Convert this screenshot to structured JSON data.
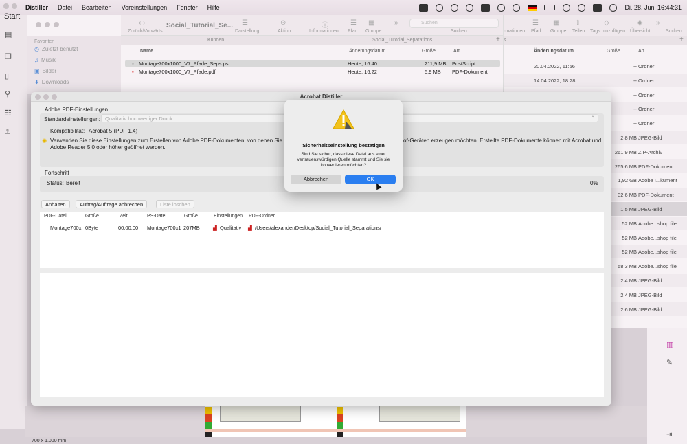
{
  "menubar": {
    "app": "Distiller",
    "items": [
      "Datei",
      "Bearbeiten",
      "Voreinstellungen",
      "Fenster",
      "Hilfe"
    ],
    "clock": "Di. 28. Juni  16:44:31"
  },
  "left_app": {
    "start_label": "Start"
  },
  "finder1": {
    "title": "Social_Tutorial_Se...",
    "toolbar_labels": [
      "Zurück/Vorwärts",
      "Darstellung",
      "Aktion",
      "Informationen",
      "Pfad",
      "Gruppe",
      "Suchen"
    ],
    "search_placeholder": "Suchen",
    "path_tabs": [
      "Kunden",
      "Social_Tutorial_Separations"
    ],
    "sidebar_header": "Favoriten",
    "sidebar_items": [
      "Zuletzt benutzt",
      "Musik",
      "Bilder",
      "Downloads"
    ],
    "columns": [
      "Name",
      "Änderungsdatum",
      "Größe",
      "Art"
    ],
    "files": [
      {
        "name": "Montage700x1000_V7_Pfade_Seps.ps",
        "date": "Heute, 16:40",
        "size": "211,9 MB",
        "kind": "PostScript"
      },
      {
        "name": "Montage700x1000_V7_Pfade.pdf",
        "date": "Heute, 16:22",
        "size": "5,9 MB",
        "kind": "PDF-Dokument"
      }
    ]
  },
  "finder2": {
    "toolbar_labels": [
      "rmationen",
      "Pfad",
      "Gruppe",
      "Teilen",
      "Tags hinzufügen",
      "Übersicht",
      "Suchen"
    ],
    "columns": [
      "Änderungsdatum",
      "Größe",
      "Art"
    ],
    "rows": [
      {
        "date": "20.04.2022, 11:56",
        "size": "--",
        "kind": "Ordner"
      },
      {
        "date": "14.04.2022, 18:28",
        "size": "--",
        "kind": "Ordner"
      },
      {
        "date": "",
        "size": "--",
        "kind": "Ordner"
      },
      {
        "date": "",
        "size": "--",
        "kind": "Ordner"
      },
      {
        "date": "",
        "size": "--",
        "kind": "Ordner"
      },
      {
        "date": "",
        "size": "2,8 MB",
        "kind": "JPEG-Bild"
      },
      {
        "date": "",
        "size": "261,9 MB",
        "kind": "ZIP-Archiv"
      },
      {
        "date": "",
        "size": "265,6 MB",
        "kind": "PDF-Dokument"
      },
      {
        "date": "",
        "size": "1,92 GB",
        "kind": "Adobe I...kument"
      },
      {
        "date": "",
        "size": "32,6 MB",
        "kind": "PDF-Dokument"
      },
      {
        "date": "",
        "size": "1,5 MB",
        "kind": "JPEG-Bild"
      },
      {
        "date": "",
        "size": "52 MB",
        "kind": "Adobe...shop file"
      },
      {
        "date": "",
        "size": "52 MB",
        "kind": "Adobe...shop file"
      },
      {
        "date": "",
        "size": "52 MB",
        "kind": "Adobe...shop file"
      },
      {
        "date": "",
        "size": "58,3 MB",
        "kind": "Adobe...shop file"
      },
      {
        "date": "",
        "size": "2,4 MB",
        "kind": "JPEG-Bild"
      },
      {
        "date": "",
        "size": "2,4 MB",
        "kind": "JPEG-Bild"
      },
      {
        "date": "",
        "size": "2,6 MB",
        "kind": "JPEG-Bild"
      }
    ]
  },
  "distiller": {
    "title": "Acrobat Distiller",
    "settings_section": "Adobe PDF-Einstellungen",
    "default_label": "Standardeinstellungen:",
    "default_value": "Qualitativ hochwertiger Druck",
    "compat_label": "Kompatibilität:",
    "compat_value": "Acrobat 5 (PDF 1.4)",
    "description_left": "Verwenden Sie diese Einstellungen zum Erstellen von Adobe PDF-Dokumenten, von denen Sie ho",
    "description_right": "of-Geräten erzeugen möchten. Erstellte PDF-Dokumente können mit Acrobat und",
    "description_line2": "Adobe Reader 5.0 oder höher geöffnet werden.",
    "progress_section": "Fortschritt",
    "status_label": "Status:",
    "status_value": "Bereit",
    "percent": "0%",
    "buttons": {
      "pause": "Anhalten",
      "cancel_jobs": "Auftrag/Aufträge abbrechen",
      "clear_list": "Liste löschen"
    },
    "job_columns": [
      "PDF-Datei",
      "Größe",
      "Zeit",
      "PS-Datei",
      "Größe",
      "Einstellungen",
      "PDF-Ordner"
    ],
    "job": {
      "pdf": "Montage700x",
      "pdf_size": "0Byte",
      "time": "00:00:00",
      "ps": "Montage700x1",
      "ps_size": "207MB",
      "settings": "Qualitativ",
      "folder": "/Users/alexander/Desktop/Social_Tutorial_Separations/"
    }
  },
  "alert": {
    "title": "Sicherheitseinstellung bestätigen",
    "message": "Sind Sie sicher, dass diese Datei aus einer vertrauenswürdigen Quelle stammt und Sie sie konvertieren möchten?",
    "cancel": "Abbrechen",
    "ok": "OK"
  },
  "zoom_label": "700 x 1.000 mm",
  "colors": {
    "accent": "#2a7ef0",
    "warning": "#f2c21b"
  }
}
